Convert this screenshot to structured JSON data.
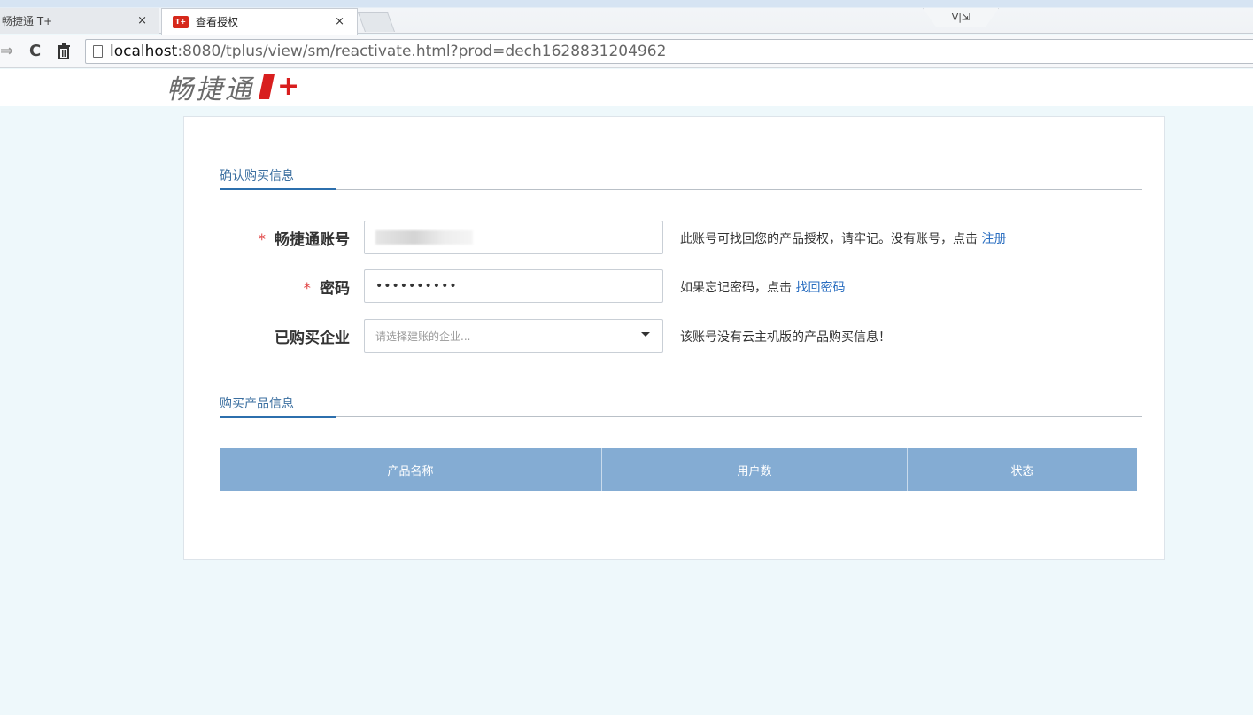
{
  "browser": {
    "tabs": [
      {
        "title": "畅捷通 T+",
        "close": "×",
        "active": false
      },
      {
        "title": "查看授权",
        "close": "×",
        "active": true,
        "favicon": "T+"
      }
    ],
    "extension_label": "V|⇲",
    "url": {
      "host": "localhost",
      "rest": ":8080/tplus/view/sm/reactivate.html?prod=dech1628831204962"
    },
    "icons": {
      "forward": "⇒",
      "reload": "C",
      "trash": "⌧"
    }
  },
  "logo": {
    "text": "畅捷通",
    "plus": "+"
  },
  "section_confirm": {
    "title": "确认购买信息"
  },
  "form": {
    "account": {
      "required_mark": "*",
      "label": "畅捷通账号",
      "hint": "此账号可找回您的产品授权，请牢记。没有账号，点击 ",
      "link": "注册"
    },
    "password": {
      "required_mark": "*",
      "label": "密码",
      "value": "••••••••••",
      "hint": "如果忘记密码，点击 ",
      "link": "找回密码"
    },
    "company": {
      "label": "已购买企业",
      "placeholder": "请选择建账的企业...",
      "hint": "该账号没有云主机版的产品购买信息！"
    }
  },
  "section_products": {
    "title": "购买产品信息"
  },
  "table": {
    "headers": [
      "产品名称",
      "用户数",
      "状态"
    ]
  },
  "colors": {
    "accent": "#2c6fad",
    "table_header": "#84acd3",
    "required": "#e04141",
    "logo_red": "#d81e1e"
  }
}
